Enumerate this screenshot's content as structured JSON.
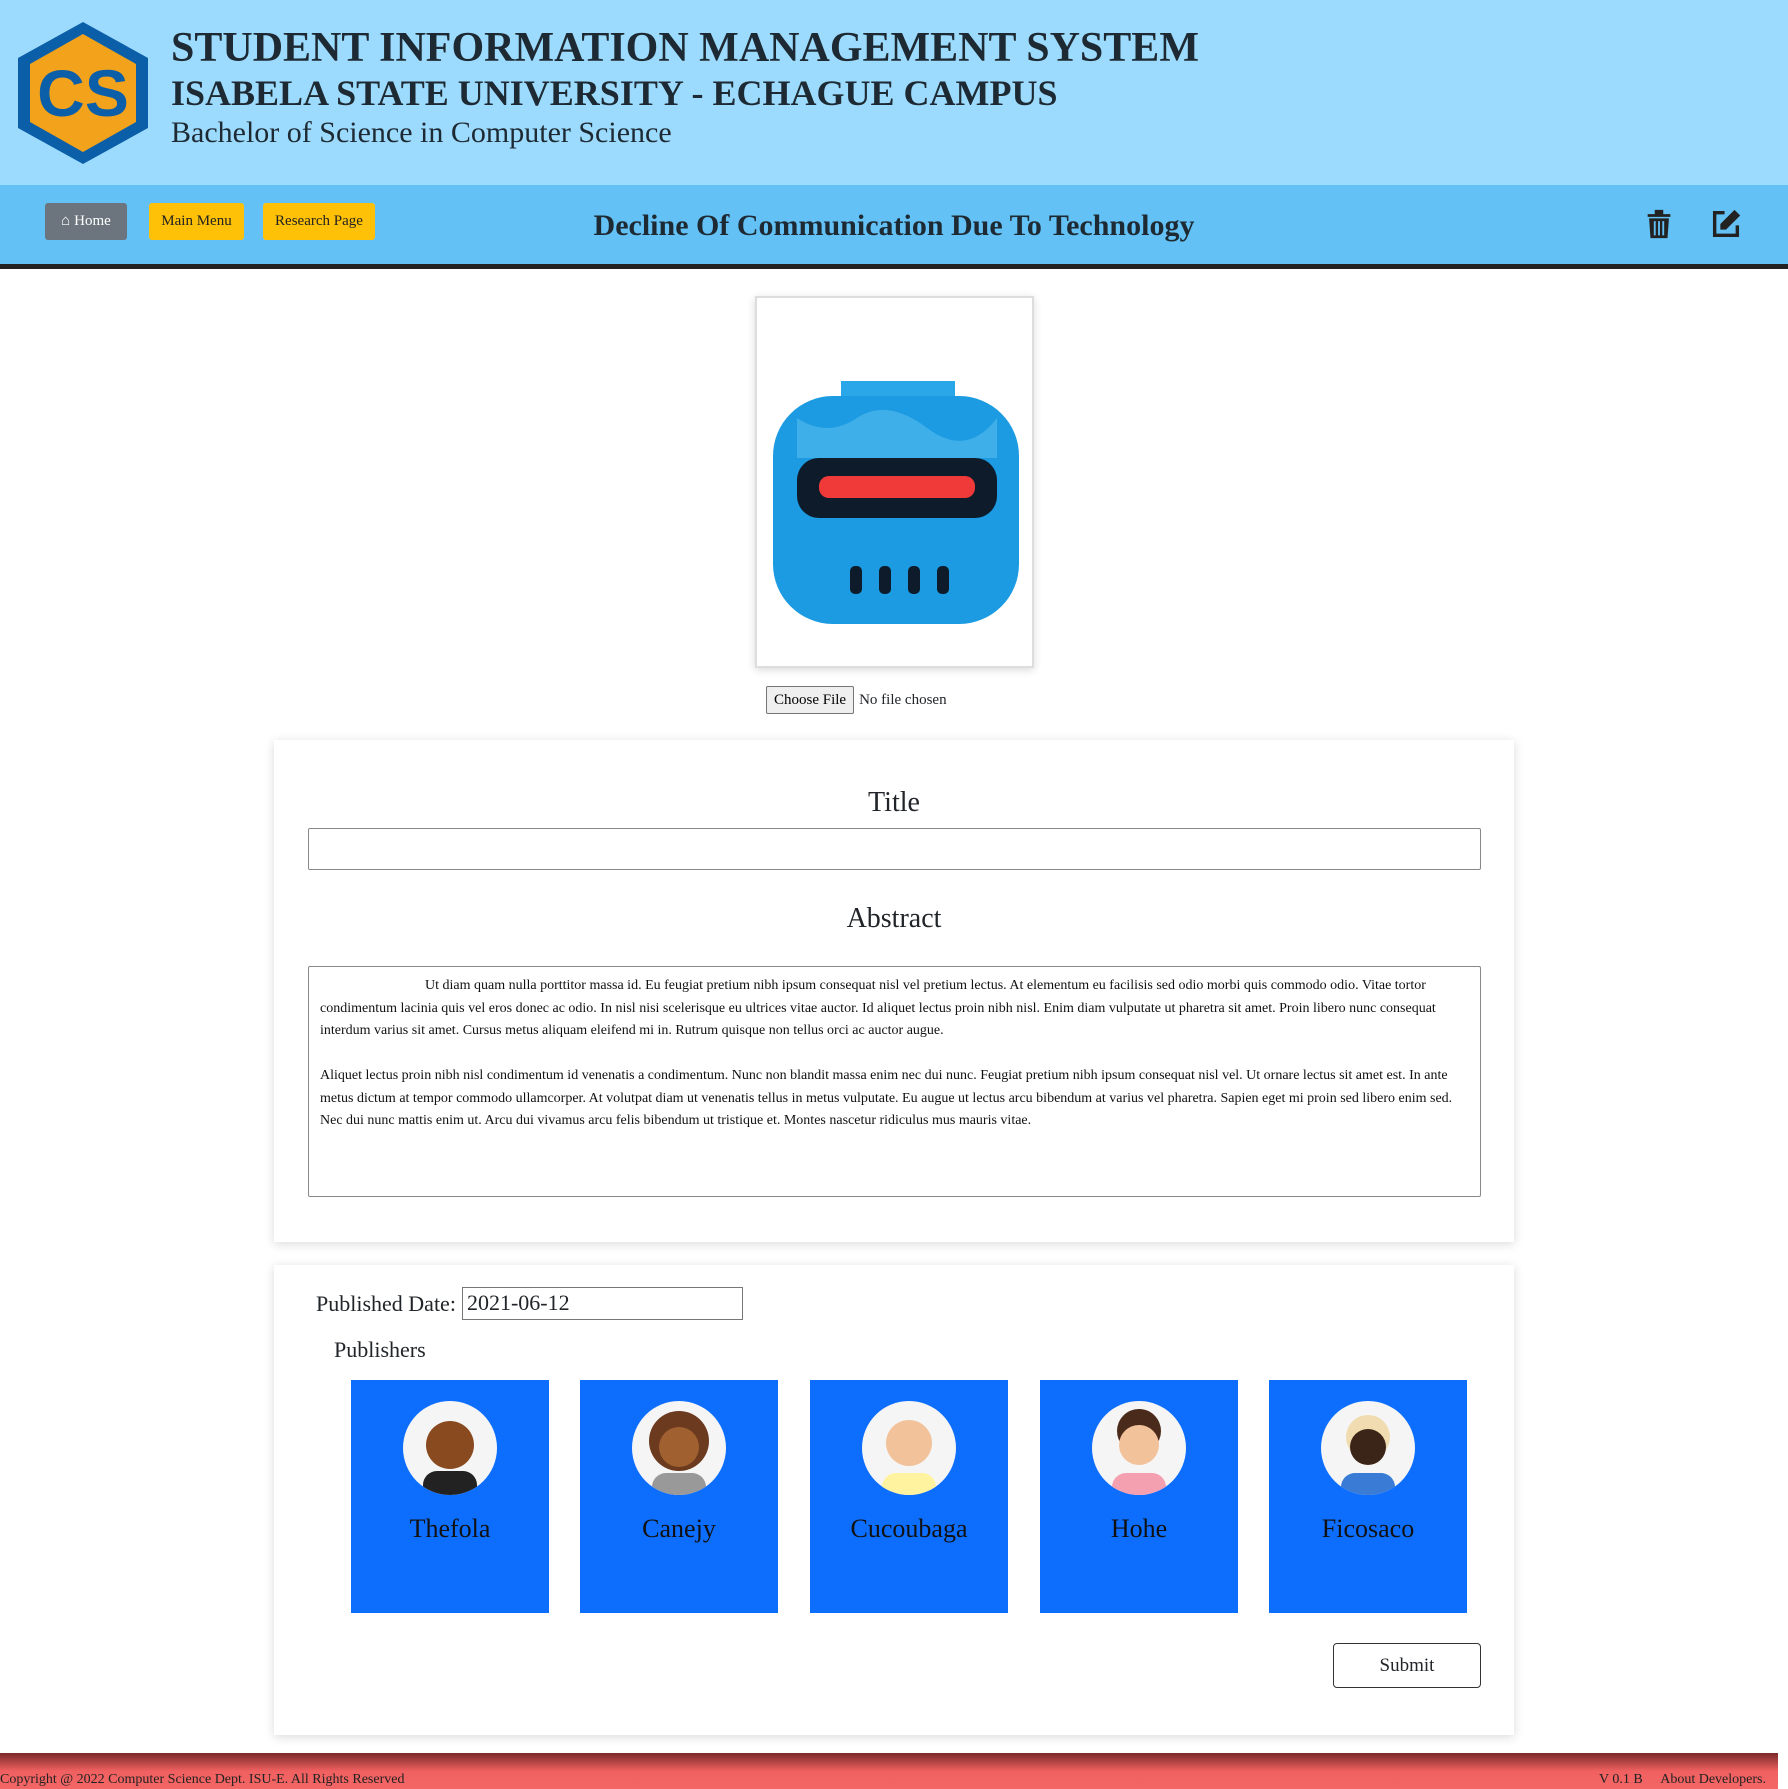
{
  "header": {
    "title": "STUDENT INFORMATION MANAGEMENT SYSTEM",
    "university": "ISABELA STATE UNIVERSITY - ECHAGUE CAMPUS",
    "program": "Bachelor of Science in Computer Science",
    "logo_text": "CS"
  },
  "nav": {
    "home": "Home",
    "main_menu": "Main Menu",
    "research_page": "Research Page",
    "page_title": "Decline Of Communication Due To Technology"
  },
  "file": {
    "button": "Choose File",
    "status": "No file chosen"
  },
  "form": {
    "title_label": "Title",
    "title_value": "",
    "abstract_label": "Abstract",
    "abstract_value": "                              Ut diam quam nulla porttitor massa id. Eu feugiat pretium nibh ipsum consequat nisl vel pretium lectus. At elementum eu facilisis sed odio morbi quis commodo odio. Vitae tortor condimentum lacinia quis vel eros donec ac odio. In nisl nisi scelerisque eu ultrices vitae auctor. Id aliquet lectus proin nibh nisl. Enim diam vulputate ut pharetra sit amet. Proin libero nunc consequat interdum varius sit amet. Cursus metus aliquam eleifend mi in. Rutrum quisque non tellus orci ac auctor augue.\n\nAliquet lectus proin nibh nisl condimentum id venenatis a condimentum. Nunc non blandit massa enim nec dui nunc. Feugiat pretium nibh ipsum consequat nisl vel. Ut ornare lectus sit amet est. In ante metus dictum at tempor commodo ullamcorper. At volutpat diam ut venenatis tellus in metus vulputate. Eu augue ut lectus arcu bibendum at varius vel pharetra. Sapien eget mi proin sed libero enim sed. Nec dui nunc mattis enim ut. Arcu dui vivamus arcu felis bibendum ut tristique et. Montes nascetur ridiculus mus mauris vitae.",
    "published_label": "Published Date:",
    "published_value": "2021-06-12",
    "publishers_label": "Publishers",
    "submit": "Submit"
  },
  "publishers": [
    {
      "name": "Thefola"
    },
    {
      "name": "Canejy"
    },
    {
      "name": "Cucoubaga"
    },
    {
      "name": "Hohe"
    },
    {
      "name": "Ficosaco"
    }
  ],
  "footer": {
    "copyright": "Copyright @ 2022 Computer Science Dept. ISU-E. All Rights Reserved",
    "version": "V 0.1 B",
    "about": "About Developers."
  },
  "colors": {
    "header": "#9cdbfd",
    "nav": "#63c1f5",
    "publisher_card": "#0d6efd",
    "footer": "#f46666"
  }
}
